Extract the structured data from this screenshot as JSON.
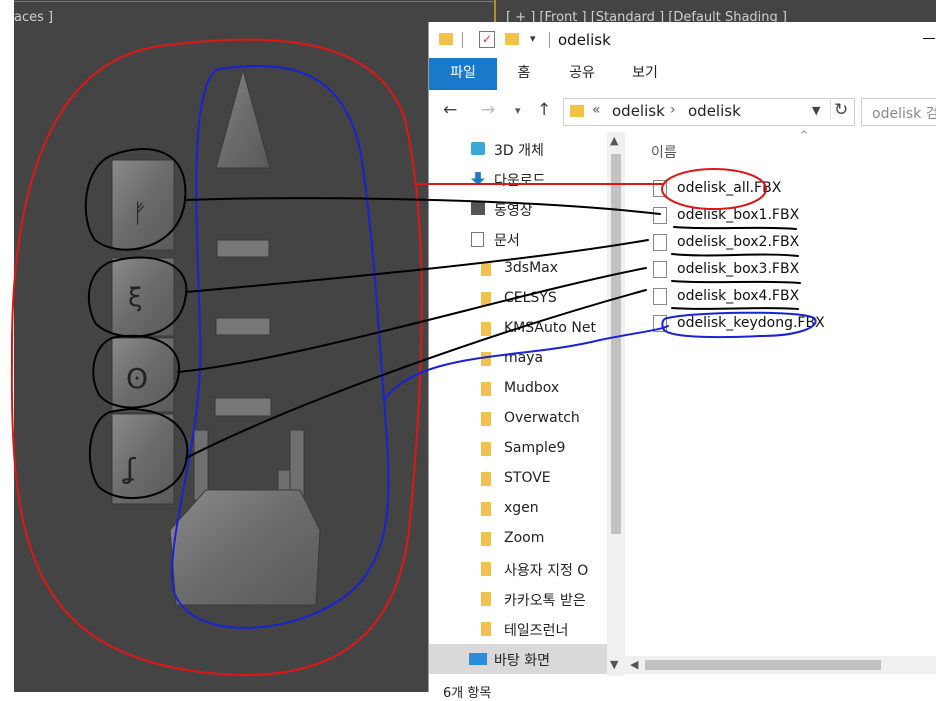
{
  "viewport": {
    "left_label": "aces ]",
    "front_label": "[ + ] [Front ] [Standard ] [Default Shading ]"
  },
  "explorer": {
    "window_title": "odelisk",
    "ribbon_tabs": [
      "파일",
      "홈",
      "공유",
      "보기"
    ],
    "address": {
      "chevrons": "«",
      "crumbs": [
        "odelisk",
        "odelisk"
      ],
      "separator": "›"
    },
    "search_placeholder": "odelisk 검",
    "nav_items": [
      {
        "label": "3D 개체",
        "icon": "3d-objects-icon"
      },
      {
        "label": "다운로드",
        "icon": "download-icon"
      },
      {
        "label": "동영상",
        "icon": "video-icon"
      },
      {
        "label": "문서",
        "icon": "document-icon"
      },
      {
        "label": "3dsMax",
        "icon": "folder-icon"
      },
      {
        "label": "CELSYS",
        "icon": "folder-icon"
      },
      {
        "label": "KMSAuto Net",
        "icon": "folder-icon"
      },
      {
        "label": "maya",
        "icon": "folder-icon"
      },
      {
        "label": "Mudbox",
        "icon": "folder-icon"
      },
      {
        "label": "Overwatch",
        "icon": "folder-icon"
      },
      {
        "label": "Sample9",
        "icon": "folder-icon"
      },
      {
        "label": "STOVE",
        "icon": "folder-icon"
      },
      {
        "label": "xgen",
        "icon": "folder-icon"
      },
      {
        "label": "Zoom",
        "icon": "folder-icon"
      },
      {
        "label": "사용자 지정 O",
        "icon": "folder-icon"
      },
      {
        "label": "카카오톡 받은",
        "icon": "folder-icon"
      },
      {
        "label": "테일즈런너",
        "icon": "folder-icon"
      },
      {
        "label": "바탕 화면",
        "icon": "desktop-icon"
      }
    ],
    "column_header": "이름",
    "files": [
      "odelisk_all.FBX",
      "odelisk_box1.FBX",
      "odelisk_box2.FBX",
      "odelisk_box3.FBX",
      "odelisk_box4.FBX",
      "odelisk_keydong.FBX"
    ],
    "status_text": "6개 항목"
  },
  "colors": {
    "annotation_red": "#e01616",
    "annotation_blue": "#1a22d6",
    "annotation_black": "#000000",
    "ribbon_accent": "#1979ca"
  }
}
